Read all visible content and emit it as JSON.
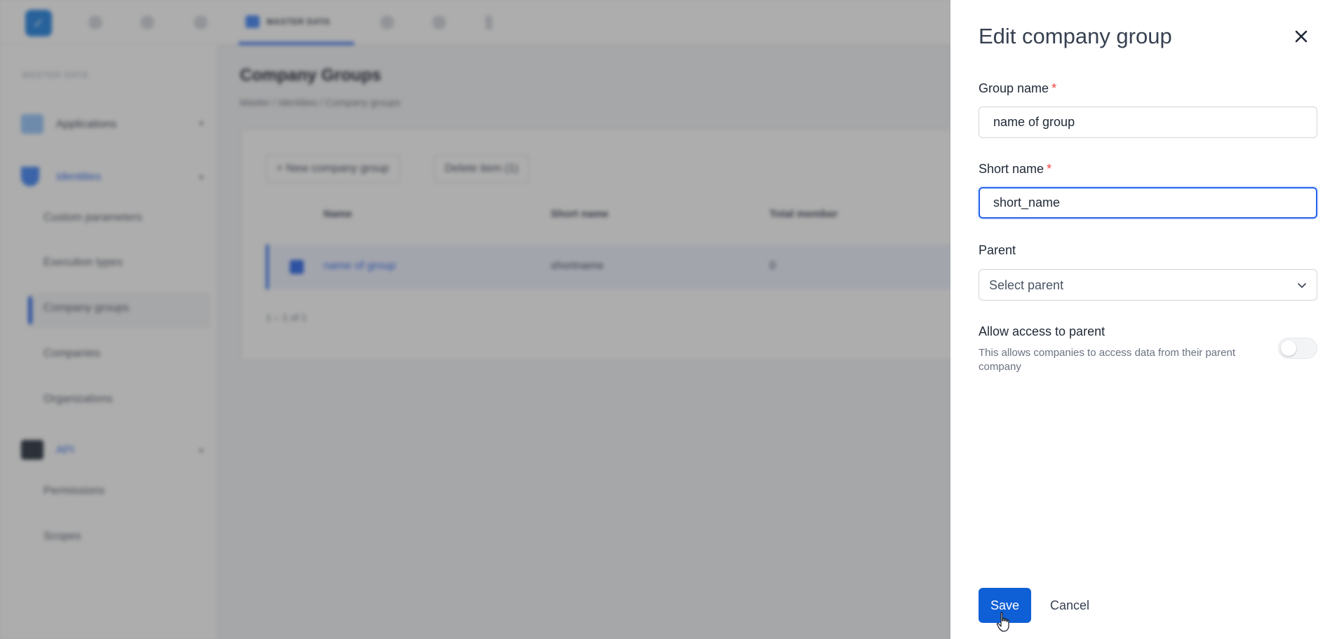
{
  "app": {
    "logo_text": "✓",
    "active_tab": "MASTER DATA"
  },
  "sidebar": {
    "section": "MASTER DATA",
    "groups": [
      {
        "label": "Applications"
      },
      {
        "label": "Identities",
        "items": [
          "Custom parameters",
          "Execution types",
          "Company groups",
          "Companies",
          "Organizations"
        ]
      },
      {
        "label": "API",
        "items": [
          "Permissions",
          "Scopes"
        ]
      }
    ]
  },
  "main": {
    "title": "Company Groups",
    "breadcrumb": "Master  /  Identities  /  Company groups",
    "new_button": "+ New company group",
    "delete_button": "Delete item (1)",
    "columns": [
      "Name",
      "Short name",
      "Total member"
    ],
    "row": {
      "name": "name of group",
      "short": "shortname",
      "total": "0"
    },
    "pager": "1 – 1 of 1"
  },
  "drawer": {
    "title": "Edit company group",
    "group_name": {
      "label": "Group name",
      "required_mark": "*",
      "value": "name of group"
    },
    "short_name": {
      "label": "Short name",
      "required_mark": "*",
      "value": "short_name"
    },
    "parent": {
      "label": "Parent",
      "placeholder": "Select parent"
    },
    "allow_access": {
      "label": "Allow access to parent",
      "description": "This allows companies to access data from their parent company",
      "enabled": false
    },
    "save_label": "Save",
    "cancel_label": "Cancel"
  },
  "colors": {
    "primary": "#0f5fd6",
    "focus_border": "#2563eb",
    "required": "#ef4444"
  }
}
